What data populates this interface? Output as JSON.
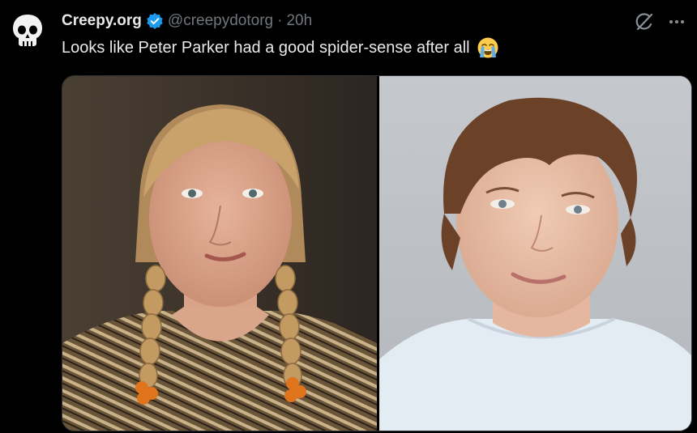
{
  "author": {
    "display_name": "Creepy.org",
    "handle": "@creepydotorg",
    "separator": "·",
    "time": "20h",
    "avatar_icon": "skull-icon",
    "verified_icon": "verified-badge-icon",
    "verified_color": "#1d9bf0"
  },
  "tweet": {
    "text": "Looks like Peter Parker had a good spider-sense after all",
    "emoji_icon": "loudly-crying-face-icon"
  },
  "actions": {
    "grok_icon": "grok-slash-icon",
    "more_icon": "more-dots-icon"
  },
  "media": {
    "images": [
      {
        "icon": "photo-woman-braids"
      },
      {
        "icon": "photo-woman-short-hair"
      }
    ]
  },
  "colors": {
    "background": "#000000",
    "text_primary": "#e7e9ea",
    "text_secondary": "#71767b",
    "accent": "#1d9bf0"
  }
}
